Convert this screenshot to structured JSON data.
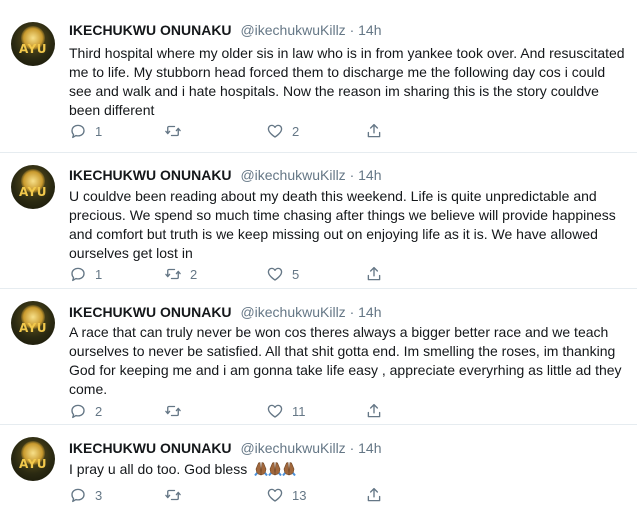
{
  "tweets": [
    {
      "name": "IKECHUKWU ONUNAKU",
      "handle": "@ikechukwuKillz",
      "separator": "·",
      "time": "14h",
      "text": "Third hospital where my older sis in law who is in from yankee took over. And resuscitated me to life. My stubborn head forced them to discharge me the following day cos i could see and walk and i hate hospitals. Now the reason im sharing this is the story couldve been different",
      "replies": "1",
      "retweets": "",
      "likes": "2"
    },
    {
      "name": "IKECHUKWU ONUNAKU",
      "handle": "@ikechukwuKillz",
      "separator": "·",
      "time": "14h",
      "text": "U couldve been reading about my death this weekend. Life is quite unpredictable and precious. We spend so much time chasing after things we believe will provide happiness and comfort but truth is we keep missing out on enjoying life as it is. We have allowed ourselves get lost in",
      "replies": "1",
      "retweets": "2",
      "likes": "5"
    },
    {
      "name": "IKECHUKWU ONUNAKU",
      "handle": "@ikechukwuKillz",
      "separator": "·",
      "time": "14h",
      "text": "A race that can truly never be won cos theres always a bigger better race and we teach ourselves to never be satisfied. All that shit gotta end. Im smelling the roses, im thanking God for keeping me and i am gonna take life easy , appreciate everyrhing as little ad they come.",
      "replies": "2",
      "retweets": "",
      "likes": "11"
    },
    {
      "name": "IKECHUKWU ONUNAKU",
      "handle": "@ikechukwuKillz",
      "separator": "·",
      "time": "14h",
      "text": "I pray u all do too. God bless",
      "emoji": "🙏🏾🙏🏾🙏🏾",
      "replies": "3",
      "retweets": "",
      "likes": "13"
    }
  ],
  "avatar_text": "AYU",
  "icons": {
    "reply": "reply-icon",
    "retweet": "retweet-icon",
    "like": "heart-icon",
    "share": "share-icon",
    "emoji": "folded-hands-icon"
  },
  "colors": {
    "text": "#14171a",
    "secondary": "#657786",
    "divider": "#e6ecf0",
    "emoji_skin": "#a0673c"
  }
}
